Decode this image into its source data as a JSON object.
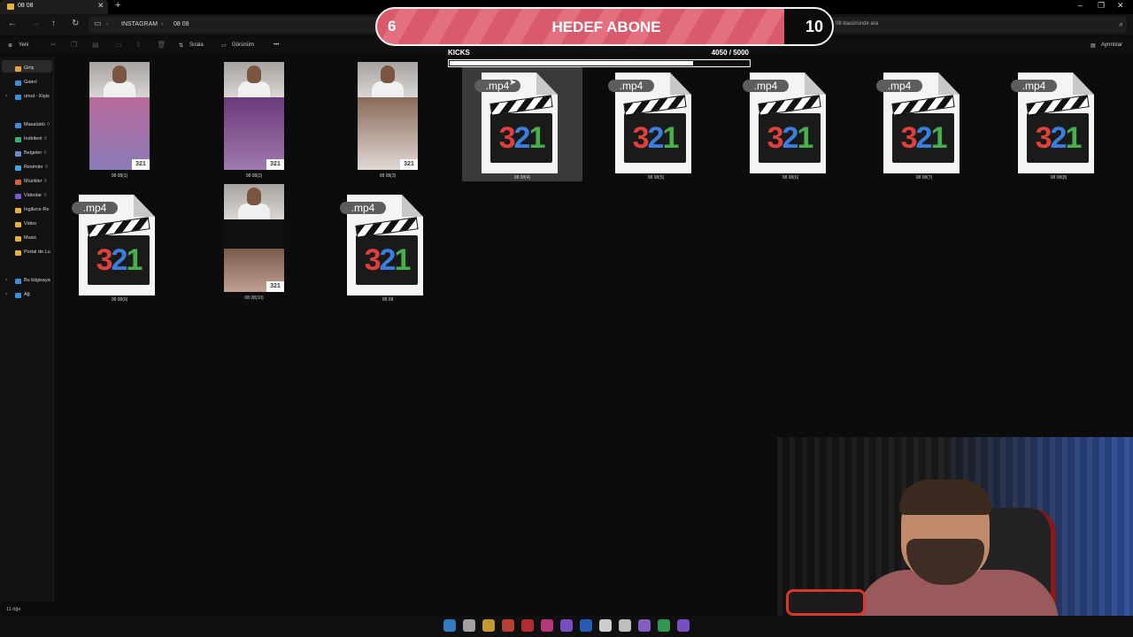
{
  "window": {
    "tab_title": "08 08",
    "new_tab": "+",
    "controls": [
      "–",
      "❐",
      "✕"
    ]
  },
  "nav": {
    "breadcrumbs": [
      "INSTAGRAM",
      "08 08"
    ],
    "search_placeholder": "08 klasöründe ara"
  },
  "toolbar": {
    "new_label": "Yeni",
    "sort_label": "Sırala",
    "view_label": "Görünüm",
    "more_label": "•••",
    "details_label": "Ayrıntılar"
  },
  "sidebar": {
    "items": [
      {
        "label": "Giriş",
        "icon": "home-icon",
        "color": "#e6a23c"
      },
      {
        "label": "Galeri",
        "icon": "gallery-icon",
        "color": "#3a8de0"
      },
      {
        "label": "umut - Kişis",
        "icon": "cloud-icon",
        "color": "#3a8de0"
      },
      {
        "label": "Masaüstü",
        "icon": "desktop-icon",
        "color": "#3a8de0"
      },
      {
        "label": "İndirilenl",
        "icon": "download-icon",
        "color": "#35b36a"
      },
      {
        "label": "Belgeler",
        "icon": "documents-icon",
        "color": "#6a8ccf"
      },
      {
        "label": "Resimler",
        "icon": "pictures-icon",
        "color": "#3aa7e0"
      },
      {
        "label": "Müzikler",
        "icon": "music-icon",
        "color": "#e05a3a"
      },
      {
        "label": "Videolar",
        "icon": "videos-icon",
        "color": "#7a56d0"
      },
      {
        "label": "İngilizce Re",
        "icon": "folder-icon",
        "color": "#e8b23a"
      },
      {
        "label": "Video",
        "icon": "folder-icon",
        "color": "#e8b23a"
      },
      {
        "label": "Music",
        "icon": "folder-icon",
        "color": "#e8b23a"
      },
      {
        "label": "Portal de Lu",
        "icon": "folder-icon",
        "color": "#e8b23a"
      },
      {
        "label": "Bu bilgisaya",
        "icon": "computer-icon",
        "color": "#3a8de0"
      },
      {
        "label": "Ağ",
        "icon": "network-icon",
        "color": "#3a8de0"
      }
    ]
  },
  "files": [
    {
      "name": "08 08(1)",
      "kind": "thumb"
    },
    {
      "name": "08 08(2)",
      "kind": "thumb"
    },
    {
      "name": "08 08(3)",
      "kind": "thumb"
    },
    {
      "name": "08 08(4)",
      "kind": "mp4",
      "selected": true
    },
    {
      "name": "08 08(5)",
      "kind": "mp4"
    },
    {
      "name": "08 08(6)",
      "kind": "mp4"
    },
    {
      "name": "08 08(7)",
      "kind": "mp4"
    },
    {
      "name": "08 08(8)",
      "kind": "mp4"
    },
    {
      "name": "08 08(9)",
      "kind": "mp4"
    },
    {
      "name": "08 08(10)",
      "kind": "thumb"
    },
    {
      "name": "08 08",
      "kind": "mp4"
    }
  ],
  "file_icon": {
    "ext": ".mp4",
    "digits": [
      "3",
      "2",
      "1"
    ],
    "badge": "321"
  },
  "overlay": {
    "left_number": "6",
    "title": "HEDEF ABONE",
    "right_number": "10",
    "kicks_label": "KICKS",
    "kicks_count": "4050  / 5000",
    "kicks_progress": 0.81
  },
  "status": {
    "item_count": "11 öğe"
  },
  "taskbar": {
    "apps": [
      {
        "icon": "windows-start-icon",
        "color": "#3a8de0"
      },
      {
        "icon": "task-view-icon",
        "color": "#bbbbbb"
      },
      {
        "icon": "file-explorer-icon",
        "color": "#e8b23a"
      },
      {
        "icon": "chrome-icon",
        "color": "#d04a3a"
      },
      {
        "icon": "opera-icon",
        "color": "#d0303a"
      },
      {
        "icon": "instagram-icon",
        "color": "#d0408a"
      },
      {
        "icon": "messenger-icon",
        "color": "#8a5ae0"
      },
      {
        "icon": "photoshop-icon",
        "color": "#2a6ad0"
      },
      {
        "icon": "tiktok-icon",
        "color": "#eeeeee"
      },
      {
        "icon": "capcut-icon",
        "color": "#dddddd"
      },
      {
        "icon": "after-effects-icon",
        "color": "#9a6ae0"
      },
      {
        "icon": "chrome-icon",
        "color": "#3ab05a"
      },
      {
        "icon": "obs-icon",
        "color": "#8a5ae0"
      }
    ]
  }
}
